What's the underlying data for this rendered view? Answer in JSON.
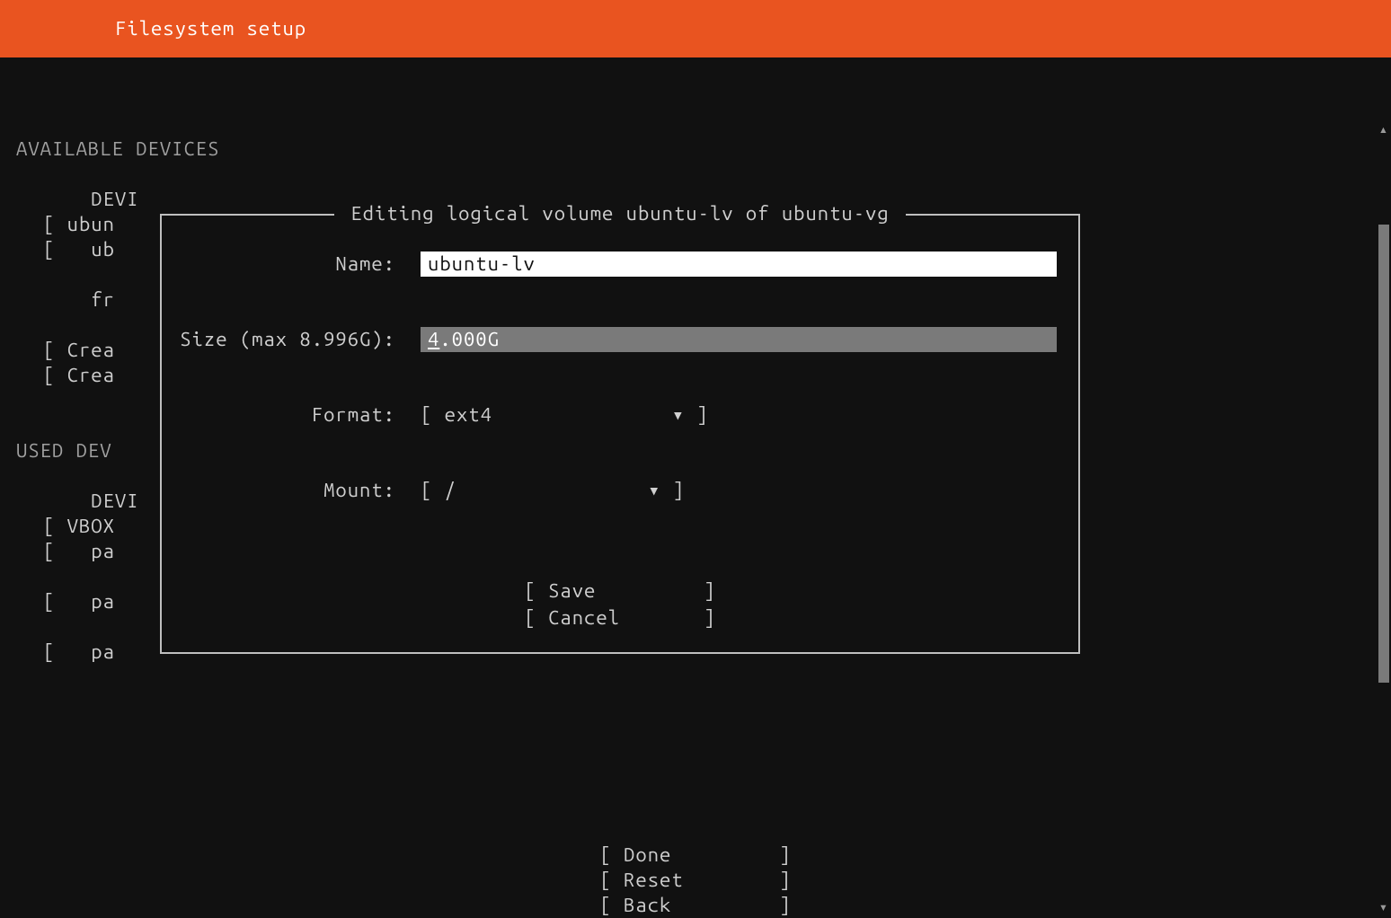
{
  "header": {
    "title": "Filesystem setup"
  },
  "background": {
    "available_heading": "AVAILABLE DEVICES",
    "available_lines": [
      "    DEVI",
      "[ ubun",
      "[   ub",
      "",
      "    fr",
      "",
      "[ Crea",
      "[ Crea"
    ],
    "used_heading": "USED DEV",
    "used_lines": [
      "    DEVI",
      "[ VBOX",
      "[   pa",
      "",
      "[   pa",
      "",
      "[   pa"
    ]
  },
  "dialog": {
    "title": "Editing logical volume ubuntu-lv of ubuntu-vg",
    "name_label": "Name:",
    "name_value": "ubuntu-lv",
    "size_label": "Size (max 8.996G):",
    "size_value_first": "4",
    "size_value_rest": ".000G",
    "format_label": "Format:",
    "format_open": "[ ",
    "format_value": "ext4",
    "format_pad": "               ",
    "format_caret": "▾",
    "format_close": " ]",
    "mount_label": "Mount:",
    "mount_open": "[ ",
    "mount_value": "/",
    "mount_pad": "                ",
    "mount_caret": "▾",
    "mount_close": " ]",
    "save_text": "[ Save         ]",
    "cancel_text": "[ Cancel       ]"
  },
  "footer": {
    "done": "[ Done         ]",
    "reset": "[ Reset        ]",
    "back": "[ Back         ]"
  }
}
